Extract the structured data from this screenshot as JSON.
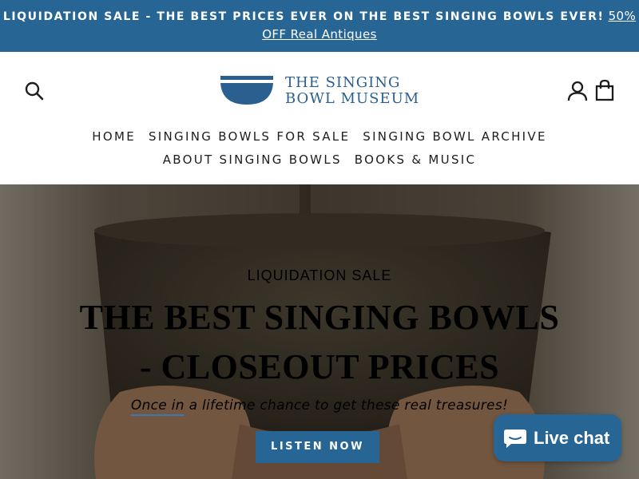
{
  "announcement": {
    "text": "LIQUIDATION SALE - THE BEST PRICES EVER ON THE BEST SINGING BOWLS EVER!",
    "link_text": "50% OFF Real Antiques"
  },
  "header": {
    "logo_line1": "THE SINGING",
    "logo_line2": "BOWL MUSEUM",
    "icons": [
      "search-icon",
      "account-icon",
      "cart-icon"
    ],
    "nav": [
      [
        "HOME",
        "SINGING BOWLS FOR SALE",
        "SINGING BOWL ARCHIVE"
      ],
      [
        "ABOUT SINGING BOWLS",
        "BOOKS & MUSIC"
      ]
    ]
  },
  "hero": {
    "subheading": "LIQUIDATION SALE",
    "title": "THE BEST SINGING BOWLS - CLOSEOUT PRICES",
    "tagline_strong": "Once in",
    "tagline_rest": " a lifetime chance to get these real treasures!",
    "button_label": "LISTEN NOW"
  },
  "chat": {
    "label": "Live chat"
  },
  "colors": {
    "brand_blue": "#276595",
    "text_dark": "#1c1d1d",
    "white": "#ffffff"
  }
}
